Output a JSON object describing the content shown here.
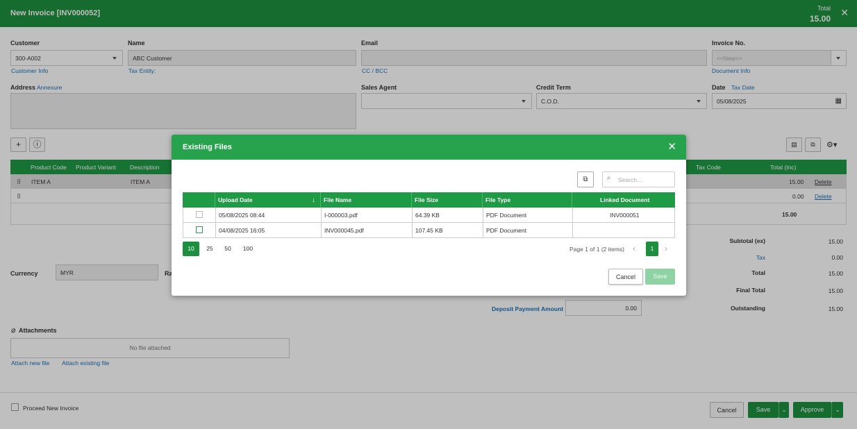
{
  "header": {
    "title": "New Invoice [INV000052]",
    "total_label": "Total",
    "total_value": "15.00",
    "close": "✕"
  },
  "form": {
    "customer_label": "Customer",
    "customer_value": "300-A002",
    "customer_info": "Customer Info",
    "name_label": "Name",
    "name_value": "ABC Customer",
    "tax_entity": "Tax Entity:",
    "email_label": "Email",
    "email_value": "",
    "cc_bcc": "CC / BCC",
    "invoice_no_label": "Invoice No.",
    "invoice_no_placeholder": "<<New>>",
    "document_info": "Document Info",
    "address_label": "Address",
    "annexure": "Annexure",
    "sales_agent_label": "Sales Agent",
    "credit_term_label": "Credit Term",
    "credit_term_value": "C.O.D.",
    "date_label": "Date",
    "tax_date": "Tax Date",
    "date_value": "05/08/2025"
  },
  "grid": {
    "headers": [
      "Product Code",
      "Product Variant",
      "Description",
      "Tax Code",
      "Total (Inc)"
    ],
    "rows": [
      {
        "code": "ITEM A",
        "desc": "ITEM A",
        "total": "15.00",
        "action": "Delete"
      },
      {
        "code": "",
        "desc": "",
        "total": "0.00",
        "action": "Delete"
      }
    ],
    "footer_total": "15.00"
  },
  "summary": {
    "subtotal_label": "Subtotal (ex)",
    "subtotal_value": "15.00",
    "tax_label": "Tax",
    "tax_value": "0.00",
    "total_label": "Total",
    "total_value": "15.00",
    "final_label": "Final Total",
    "final_value": "15.00",
    "outstanding_label": "Outstanding",
    "outstanding_value": "15.00",
    "deposit_label": "Deposit Payment Amount",
    "deposit_value": "0.00"
  },
  "currency": {
    "label": "Currency",
    "value": "MYR",
    "rate_label": "Ra"
  },
  "attachments": {
    "label": "Attachments",
    "empty": "No file attached",
    "attach_new": "Attach new file",
    "attach_existing": "Attach existing file"
  },
  "footer": {
    "proceed_label": "Proceed New Invoice",
    "cancel": "Cancel",
    "save": "Save",
    "approve": "Approve"
  },
  "modal": {
    "title": "Existing Files",
    "search_placeholder": "Search...",
    "columns": [
      "Upload Date",
      "File Name",
      "File Size",
      "File Type",
      "Linked Document"
    ],
    "files": [
      {
        "upload_date": "05/08/2025 08:44",
        "file_name": "I-000003.pdf",
        "file_size": "64.39 KB",
        "file_type": "PDF Document",
        "linked": "INV000051"
      },
      {
        "upload_date": "04/08/2025 16:05",
        "file_name": "INV000045.pdf",
        "file_size": "107.45 KB",
        "file_type": "PDF Document",
        "linked": ""
      }
    ],
    "page_sizes": [
      "10",
      "25",
      "50",
      "100"
    ],
    "page_info": "Page 1 of 1 (2 items)",
    "current_page": "1",
    "cancel": "Cancel",
    "save": "Save"
  },
  "colors": {
    "brand_green": "#1e8f3e",
    "header_green": "#26a34c",
    "link_blue": "#1d6fb8"
  }
}
